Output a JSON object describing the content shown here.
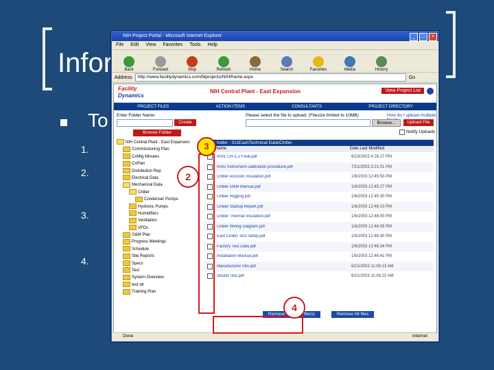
{
  "slide": {
    "title": "Infor",
    "bullet": "To",
    "steps": [
      "1.",
      "2.",
      "3.",
      "4."
    ]
  },
  "browser": {
    "window_title": "NIH Project Portal - Microsoft Internet Explorer",
    "menu": [
      "File",
      "Edit",
      "View",
      "Favorites",
      "Tools",
      "Help"
    ],
    "toolbar": [
      {
        "label": "Back",
        "icon": "back-arrow-icon",
        "color": "#3a9a3a"
      },
      {
        "label": "Forward",
        "icon": "forward-arrow-icon",
        "color": "#9a9a9a"
      },
      {
        "label": "Stop",
        "icon": "stop-icon",
        "color": "#c83a1a"
      },
      {
        "label": "Refresh",
        "icon": "refresh-icon",
        "color": "#3a9a3a"
      },
      {
        "label": "Home",
        "icon": "home-icon",
        "color": "#8a6a3a"
      },
      {
        "label": "Search",
        "icon": "search-icon",
        "color": "#5a7ab8"
      },
      {
        "label": "Favorites",
        "icon": "favorites-star-icon",
        "color": "#e8b818"
      },
      {
        "label": "Media",
        "icon": "media-icon",
        "color": "#3a7ab8"
      },
      {
        "label": "History",
        "icon": "history-icon",
        "color": "#5a8a5a"
      }
    ],
    "address_label": "Address",
    "address": "http://www.facilitydynamics.com/fdprojects/NIH/frame.aspx",
    "go_label": "Go",
    "status_left": "Done",
    "status_right": "Internet"
  },
  "site": {
    "logo_line1": "Facility",
    "logo_line2": "Dynamics",
    "project_title": "NIH Central Plant - East Expansion",
    "view_project_list": "View Project List",
    "nav": [
      "PROJECT FILES",
      "ACTION ITEMS",
      "CONSULTANTS",
      "PROJECT DIRECTORY"
    ],
    "enter_folder_label": "Enter Folder Name:",
    "create_label": "Create",
    "browse_folder_label": "Browse Folder",
    "select_file_label": "Please select the file to upload: (Filesize limited to 10MB)",
    "how_many_label": "How do I upload multiple files?",
    "browse_label": "Browse...",
    "upload_file_label": "Upload File",
    "notify_label": "Notify Uploads",
    "path_label": "Main folder : 011East\\Technical Data\\Chiller",
    "col_name": "Name",
    "col_date": "Date Last Modified",
    "remove_selected": "Remove selected file(s)",
    "remove_all": "Remove All files"
  },
  "tree": [
    {
      "label": "NIH Central Plant - East Expansion",
      "indent": 0,
      "open": true
    },
    {
      "label": "Commissioning Plan",
      "indent": 1,
      "open": false
    },
    {
      "label": "CxMtg Minutes",
      "indent": 1,
      "open": false
    },
    {
      "label": "CxPlan",
      "indent": 1,
      "open": false
    },
    {
      "label": "Distribution Rep",
      "indent": 1,
      "open": false
    },
    {
      "label": "Electrical Data",
      "indent": 1,
      "open": false
    },
    {
      "label": "Mechanical Data",
      "indent": 1,
      "open": true
    },
    {
      "label": "Chiller",
      "indent": 2,
      "open": true
    },
    {
      "label": "Condenser Pumps",
      "indent": 3,
      "open": false
    },
    {
      "label": "Hydronic Pumps",
      "indent": 2,
      "open": false
    },
    {
      "label": "Humidifiers",
      "indent": 2,
      "open": false
    },
    {
      "label": "Ventilation",
      "indent": 2,
      "open": false
    },
    {
      "label": "VFDs",
      "indent": 2,
      "open": false
    },
    {
      "label": "O&M Plan",
      "indent": 1,
      "open": false
    },
    {
      "label": "Progress Meetings",
      "indent": 1,
      "open": false
    },
    {
      "label": "Schedule",
      "indent": 1,
      "open": false
    },
    {
      "label": "Site Reports",
      "indent": 1,
      "open": false
    },
    {
      "label": "Specs",
      "indent": 1,
      "open": false
    },
    {
      "label": "Test",
      "indent": 1,
      "open": false
    },
    {
      "label": "System Overview",
      "indent": 1,
      "open": false
    },
    {
      "label": "test dir",
      "indent": 1,
      "open": false
    },
    {
      "label": "Training Plan",
      "indent": 1,
      "open": false
    }
  ],
  "files": [
    {
      "name": "0001 CH-1,2 Final.pdf",
      "date": "6/23/2003 4:26:27 PM"
    },
    {
      "name": "0002 Instrument calibration procedure.pdf",
      "date": "7/21/2003 3:21:01 PM"
    },
    {
      "name": "Chiller Acoustic Insulation.pdf",
      "date": "1/6/2003 12:45:50 PM"
    },
    {
      "name": "Chiller O&M Manual.pdf",
      "date": "1/6/2003 12:45:27 PM"
    },
    {
      "name": "Chiller Rigging.pdf",
      "date": "1/6/2003 12:45:30 PM"
    },
    {
      "name": "Chiller Startup Report.pdf",
      "date": "1/6/2003 12:46:10 PM"
    },
    {
      "name": "Chiller Thermal Insulation.pdf",
      "date": "1/6/2003 12:46:00 PM"
    },
    {
      "name": "Chiller Wiring Diagram.pdf",
      "date": "1/6/2003 12:46:05 PM"
    },
    {
      "name": "East Chiller Test Setup.pdf",
      "date": "1/6/2003 12:46:30 PM"
    },
    {
      "name": "Factory Test Data.pdf",
      "date": "1/6/2003 12:46:34 PM"
    },
    {
      "name": "Installation Manual.pdf",
      "date": "1/6/2003 12:46:41 PM"
    },
    {
      "name": "Manufacturer Info.pdf",
      "date": "6/21/2003 11:06:13 AM"
    },
    {
      "name": "Sound Test.pdf",
      "date": "6/21/2003 11:06:22 AM"
    }
  ],
  "callouts": [
    "2",
    "3",
    "4"
  ],
  "colors": {
    "background": "#1d4a78",
    "accent_red": "#d01818",
    "nav_blue": "#0a3a8c"
  }
}
